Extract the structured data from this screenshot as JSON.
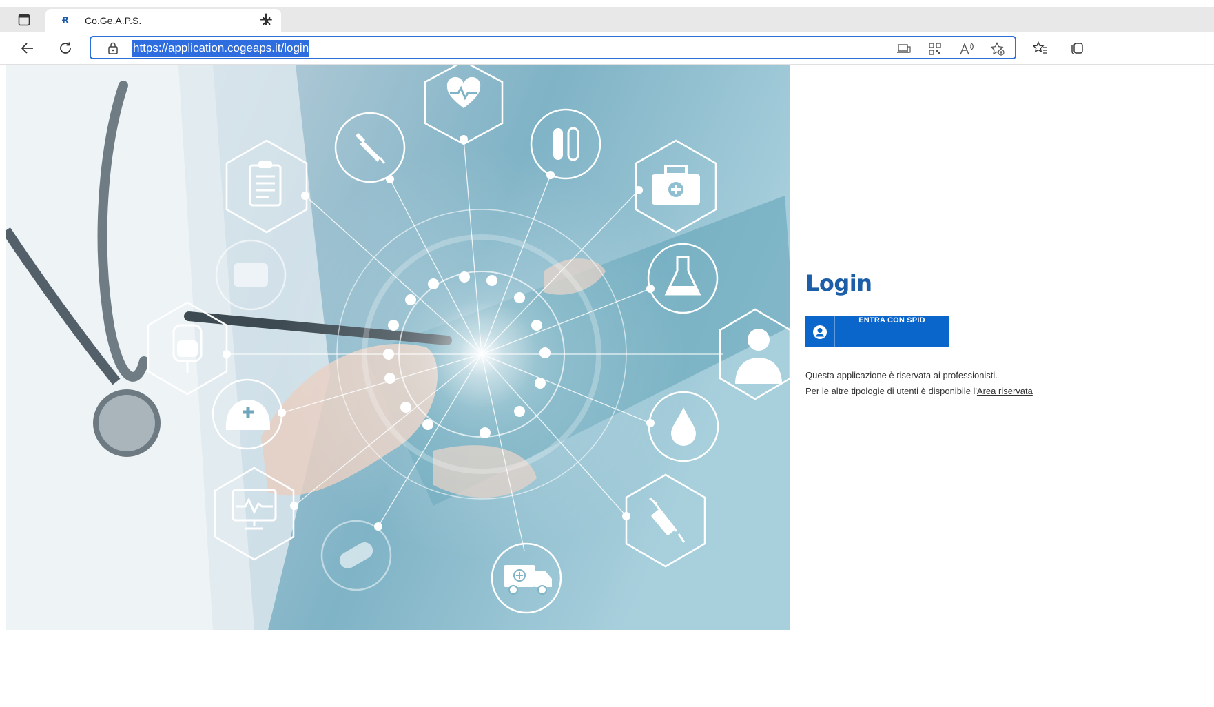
{
  "browser": {
    "tab": {
      "favicon": "Ɍ",
      "title": "Co.Ge.A.P.S.",
      "close": "×"
    },
    "new_tab": "+",
    "url": "https://application.cogeaps.it/login",
    "icons": [
      "tab-actions-icon",
      "back-icon",
      "refresh-icon",
      "lock-icon",
      "device-icon",
      "qr-code-icon",
      "read-aloud-icon",
      "add-favorite-icon",
      "favorites-icon",
      "collections-icon"
    ]
  },
  "hero": {
    "icons": [
      "heart-icon",
      "dropper-icon",
      "test-tubes-icon",
      "first-aid-kit-icon",
      "clipboard-icon",
      "pills-icon",
      "flask-icon",
      "iv-bag-icon",
      "doctor-icon",
      "nurse-cap-icon",
      "blood-drop-icon",
      "monitor-icon",
      "capsule-icon",
      "syringe-icon",
      "ambulance-icon"
    ]
  },
  "login": {
    "title": "Login",
    "spid_label": "ENTRA CON SPID",
    "info_line1": "Questa applicazione è riservata ai professionisti.",
    "info_line2_prefix": "Per le altre tipologie di utenti è disponibile l'",
    "info_link": "Area riservata"
  },
  "colors": {
    "accent": "#0b66cc",
    "title": "#1d5ea8",
    "url_highlight": "#2d6de0"
  }
}
